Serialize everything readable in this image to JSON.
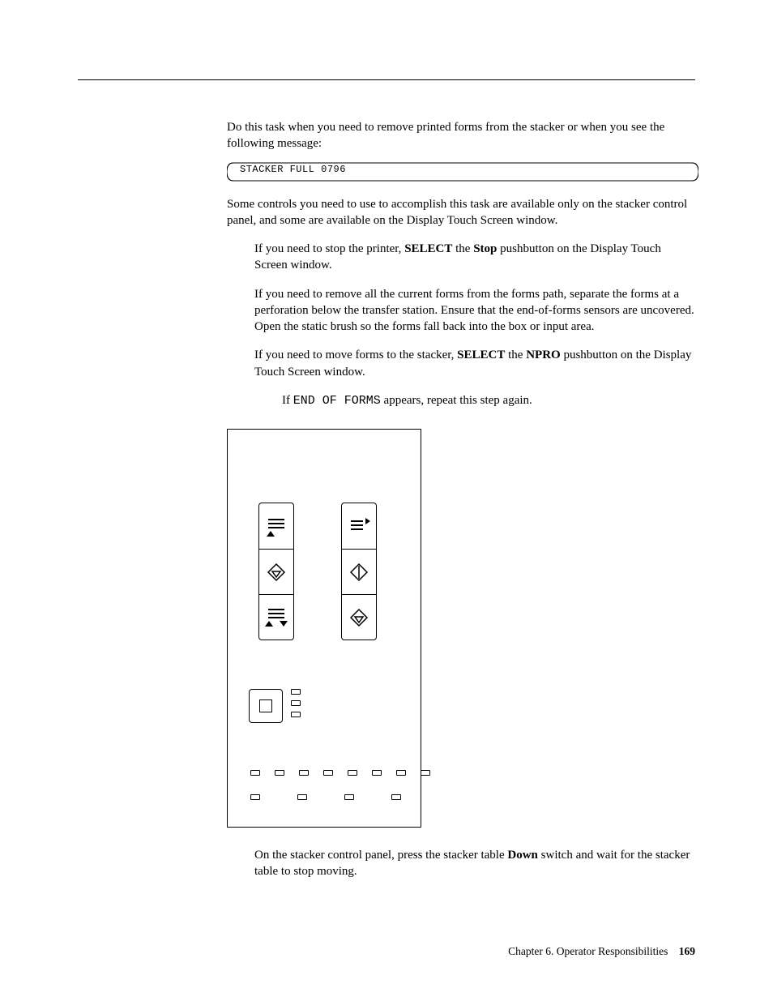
{
  "intro": "Do this task when you need to remove printed forms from the stacker or when you see the following message:",
  "callout_text": "STACKER FULL  0796",
  "para1": "Some controls you need to use to accomplish this task are available only on the stacker control panel, and some are available on the Display Touch Screen window.",
  "bullet1a": "If you need to stop the printer, ",
  "bullet1_select": "SELECT",
  "bullet1b": " the ",
  "bullet1_stop": "Stop",
  "bullet1c": " pushbutton on the Display Touch Screen window.",
  "bullet2": "If you need to remove all the current forms from the forms path, separate the forms at a perforation below the transfer station. Ensure that the end-of-forms sensors are uncovered. Open the static brush so the forms fall back into the box or input area.",
  "bullet3a": "If you need to move forms to the stacker, ",
  "bullet3_select": "SELECT",
  "bullet3b": " the ",
  "bullet3_npro": "NPRO",
  "bullet3c": " pushbutton on the Display Touch Screen window.",
  "bullet4a": "If ",
  "bullet4_code": "END OF FORMS",
  "bullet4b": " appears, repeat this step again.",
  "after1": "On the stacker control panel, press the stacker table ",
  "after_down": "Down",
  "after2": " switch and wait for the stacker table to stop moving.",
  "footer_chapter": "Chapter 6. Operator Responsibilities",
  "footer_page": "169"
}
